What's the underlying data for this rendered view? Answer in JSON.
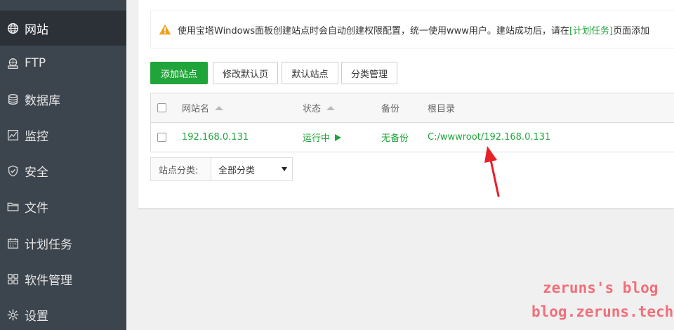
{
  "sidebar": {
    "items": [
      {
        "label": "网站",
        "icon": "globe-icon",
        "active": true
      },
      {
        "label": "FTP",
        "icon": "ftp-server-icon",
        "active": false
      },
      {
        "label": "数据库",
        "icon": "database-icon",
        "active": false
      },
      {
        "label": "监控",
        "icon": "monitor-chart-icon",
        "active": false
      },
      {
        "label": "安全",
        "icon": "shield-icon",
        "active": false
      },
      {
        "label": "文件",
        "icon": "folder-icon",
        "active": false
      },
      {
        "label": "计划任务",
        "icon": "calendar-icon",
        "active": false
      },
      {
        "label": "软件管理",
        "icon": "apps-grid-icon",
        "active": false
      },
      {
        "label": "设置",
        "icon": "gear-icon",
        "active": false
      }
    ]
  },
  "notice": {
    "text_before": "使用宝塔Windows面板创建站点时会自动创建权限配置，统一使用www用户。建站成功后，请在",
    "link": "[计划任务]",
    "text_after": "页面添加"
  },
  "toolbar": {
    "add_site": "添加站点",
    "edit_default_page": "修改默认页",
    "default_site": "默认站点",
    "category_manage": "分类管理"
  },
  "table": {
    "headers": {
      "name": "网站名",
      "status": "状态",
      "backup": "备份",
      "root": "根目录"
    },
    "rows": [
      {
        "name": "192.168.0.131",
        "status": "运行中",
        "backup": "无备份",
        "root": "C:/wwwroot/192.168.0.131"
      }
    ]
  },
  "filter": {
    "label": "站点分类:",
    "selected": "全部分类"
  },
  "watermark": {
    "line1": "zeruns's blog",
    "line2": "blog.zeruns.tech"
  },
  "colors": {
    "sidebar_bg": "#3c444d",
    "sidebar_active": "#2c3138",
    "accent_green": "#20a53a",
    "warning_orange": "#f0a020",
    "annotation_red": "#e8202a",
    "watermark_pink": "#f0707a"
  }
}
